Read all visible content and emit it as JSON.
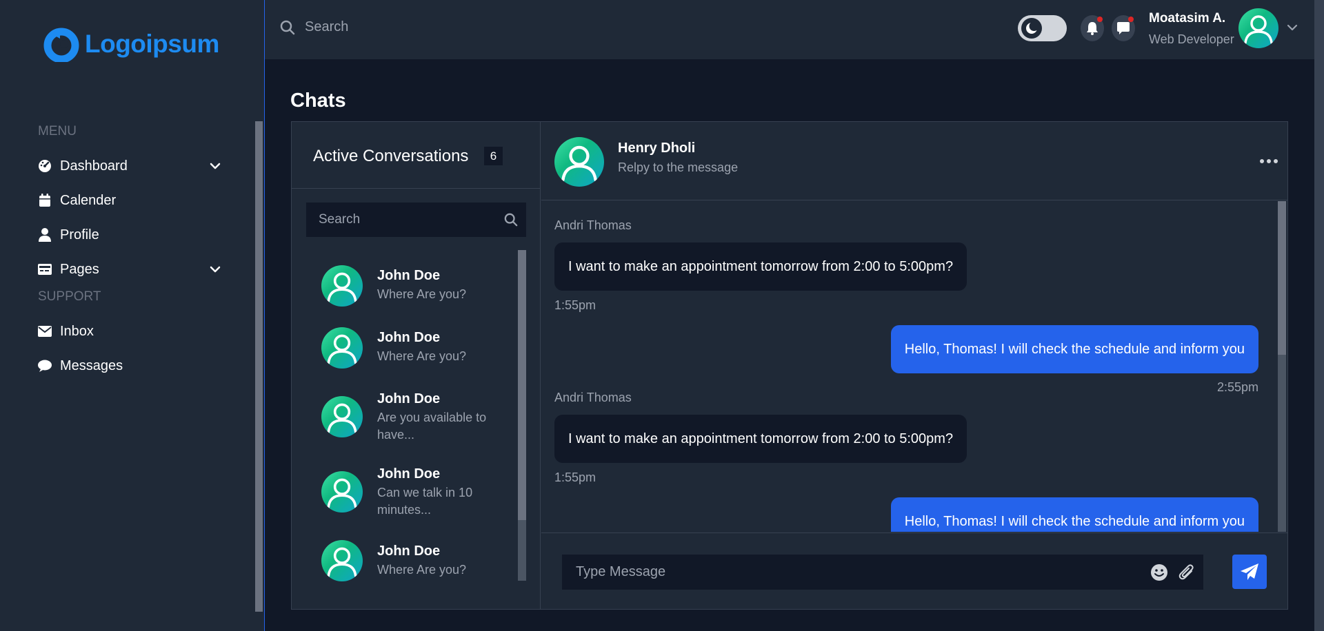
{
  "brand": {
    "name": "Logoipsum",
    "color": "#1d8bf1"
  },
  "sidebar": {
    "menu_heading": "MENU",
    "support_heading": "SUPPORT",
    "menu_items": [
      {
        "label": "Dashboard",
        "icon": "dashboard-gauge-icon",
        "has_submenu": true
      },
      {
        "label": "Calender",
        "icon": "calendar-icon",
        "has_submenu": false
      },
      {
        "label": "Profile",
        "icon": "user-icon",
        "has_submenu": false
      },
      {
        "label": "Pages",
        "icon": "pages-card-icon",
        "has_submenu": true
      }
    ],
    "support_items": [
      {
        "label": "Inbox",
        "icon": "envelope-icon"
      },
      {
        "label": "Messages",
        "icon": "chat-bubble-icon"
      }
    ]
  },
  "header": {
    "search_placeholder": "Search",
    "theme_toggle_icon": "moon-icon",
    "notifications_icon": "bell-icon",
    "messages_icon": "message-icon",
    "user": {
      "name": "Moatasim A.",
      "role": "Web Developer"
    }
  },
  "page": {
    "title": "Chats"
  },
  "conversations": {
    "title": "Active Conversations",
    "count": "6",
    "search_placeholder": "Search",
    "items": [
      {
        "name": "John Doe",
        "message": "Where Are you?"
      },
      {
        "name": "John Doe",
        "message": "Where Are you?"
      },
      {
        "name": "John Doe",
        "message": "Are you available to have..."
      },
      {
        "name": "John Doe",
        "message": "Can we talk in 10 minutes..."
      },
      {
        "name": "John Doe",
        "message": "Where Are you?"
      }
    ]
  },
  "chat": {
    "contact_name": "Henry Dholi",
    "contact_status": "Relpy to the message",
    "messages": [
      {
        "direction": "in",
        "sender": "Andri Thomas",
        "text": "I want to make an appointment tomorrow from 2:00 to 5:00pm?",
        "time": "1:55pm"
      },
      {
        "direction": "out",
        "text": "Hello, Thomas! I will check the schedule and inform you",
        "time": "2:55pm"
      },
      {
        "direction": "in",
        "sender": "Andri Thomas",
        "text": "I want to make an appointment tomorrow from 2:00 to 5:00pm?",
        "time": "1:55pm"
      },
      {
        "direction": "out",
        "text": "Hello, Thomas! I will check the schedule and inform you",
        "time": ""
      }
    ],
    "compose_placeholder": "Type Message"
  },
  "colors": {
    "background": "#111827",
    "panel": "#1f2937",
    "accent": "#2563eb",
    "avatar_gradient_start": "#3ee0a5",
    "avatar_gradient_end": "#0ea5c9",
    "notification_dot": "#dc2626"
  }
}
